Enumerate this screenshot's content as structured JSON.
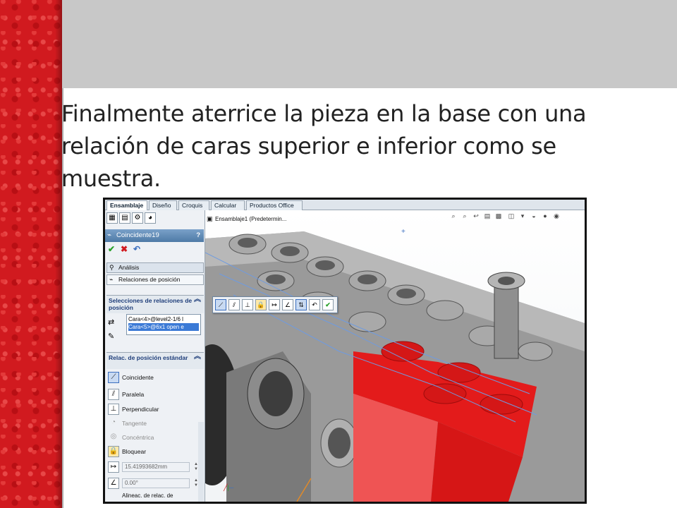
{
  "slide": {
    "bullet_text": "Finalmente aterrice la pieza en la base con una relación de caras superior e inferior como se muestra."
  },
  "app": {
    "tabs": [
      {
        "label": "Ensamblaje"
      },
      {
        "label": "Diseño"
      },
      {
        "label": "Croquis"
      },
      {
        "label": "Calcular"
      },
      {
        "label": "Productos Office"
      }
    ],
    "feature": {
      "title": "Coincidente19",
      "help": "?"
    },
    "analysis_tab": "Análisis",
    "relations_tab": "Relaciones de posición",
    "selections": {
      "header": "Selecciones de relaciones de posición",
      "items": [
        "Cara<4>@level2-1/6 l",
        "Cara<5>@6x1 open e"
      ]
    },
    "standard": {
      "header": "Relac. de posición estándar",
      "options": [
        {
          "label": "Coincidente",
          "active": true
        },
        {
          "label": "Paralela",
          "active": false
        },
        {
          "label": "Perpendicular",
          "active": false
        },
        {
          "label": "Tangente",
          "active": false,
          "disabled": true
        },
        {
          "label": "Concéntrica",
          "active": false,
          "disabled": true
        },
        {
          "label": "Bloquear",
          "active": false
        }
      ],
      "distance_value": "15.41993682mm",
      "angle_value": "0.00°",
      "align_label": "Alineac. de relac. de"
    },
    "viewport": {
      "tree_label": "Ensamblaje1 (Predetermin..."
    }
  },
  "colors": {
    "accent_red": "#d11a1f",
    "highlight_part": "#e31b1b",
    "panel_title_blue": "#4e7aa6"
  }
}
